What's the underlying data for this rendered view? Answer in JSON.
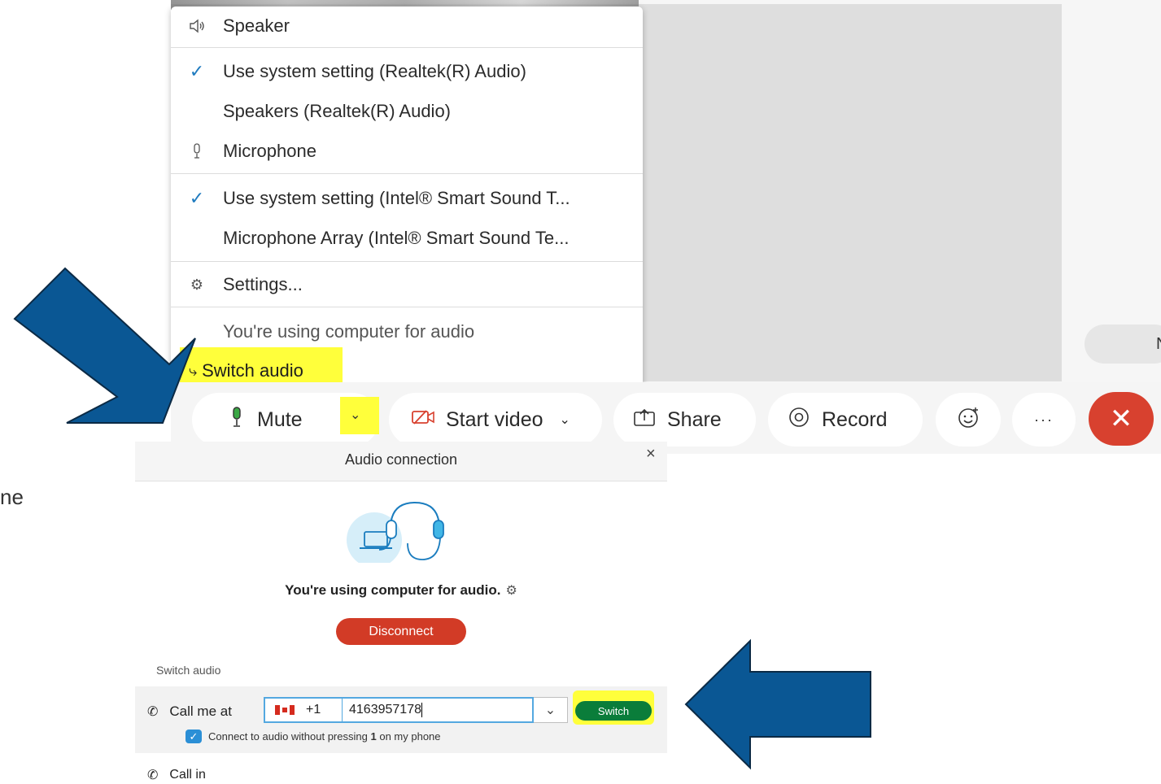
{
  "colors": {
    "highlight": "#ffff3b",
    "arrow_fill": "#0a5794",
    "arrow_stroke": "#0b2a45",
    "end_call": "#d8412f",
    "disconnect": "#d23b26",
    "switch_green": "#0a7d3a",
    "check_blue": "#1f7bbf"
  },
  "audio_menu": {
    "speaker_heading": "Speaker",
    "speaker_option_1": "Use system setting (Realtek(R) Audio)",
    "speaker_option_2": "Speakers (Realtek(R) Audio)",
    "microphone_heading": "Microphone",
    "mic_option_1": "Use system setting (Intel® Smart Sound T...",
    "mic_option_2": "Microphone Array (Intel® Smart Sound Te...",
    "settings": "Settings...",
    "status": "You're using computer for audio",
    "switch_audio": "Switch audio"
  },
  "toolbar": {
    "mute": "Mute",
    "start_video": "Start video",
    "share": "Share",
    "record": "Record"
  },
  "side_pill_text": "N",
  "cut_text": "ne",
  "dialog": {
    "title": "Audio connection",
    "status": "You're using computer for audio.",
    "disconnect": "Disconnect",
    "switch_heading": "Switch audio",
    "call_me_label": "Call me at",
    "country_code": "+1",
    "phone_number": "4163957178",
    "switch_button": "Switch",
    "connect_text_a": "Connect to audio without pressing",
    "connect_text_b": "1",
    "connect_text_c": "on my phone",
    "call_in": "Call in"
  }
}
